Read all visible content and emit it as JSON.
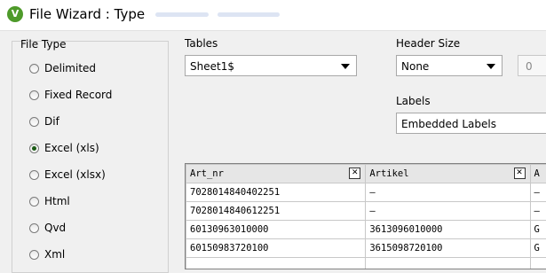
{
  "window": {
    "title": "File Wizard : Type",
    "icon": "qlikview-v-icon",
    "icon_letter": "V"
  },
  "file_type": {
    "label": "File Type",
    "options": [
      "Delimited",
      "Fixed Record",
      "Dif",
      "Excel (xls)",
      "Excel (xlsx)",
      "Html",
      "Qvd",
      "Xml"
    ],
    "selected": "Excel (xls)"
  },
  "tables": {
    "label": "Tables",
    "value": "Sheet1$"
  },
  "header_size": {
    "label": "Header Size",
    "value": "None",
    "number": "0"
  },
  "labels": {
    "label": "Labels",
    "value": "Embedded Labels"
  },
  "preview": {
    "columns": [
      "Art_nr",
      "Artikel",
      "A"
    ],
    "rows": [
      [
        "7028014840402251",
        "–",
        "–"
      ],
      [
        "7028014840612251",
        "–",
        "–"
      ],
      [
        "60130963010000",
        "3613096010000",
        "G"
      ],
      [
        "60150983720100",
        "3615098720100",
        "G"
      ],
      [
        "",
        "",
        ""
      ]
    ]
  },
  "colors": {
    "highlight": "#f7f700",
    "radio_selected": "#1a5a14"
  }
}
